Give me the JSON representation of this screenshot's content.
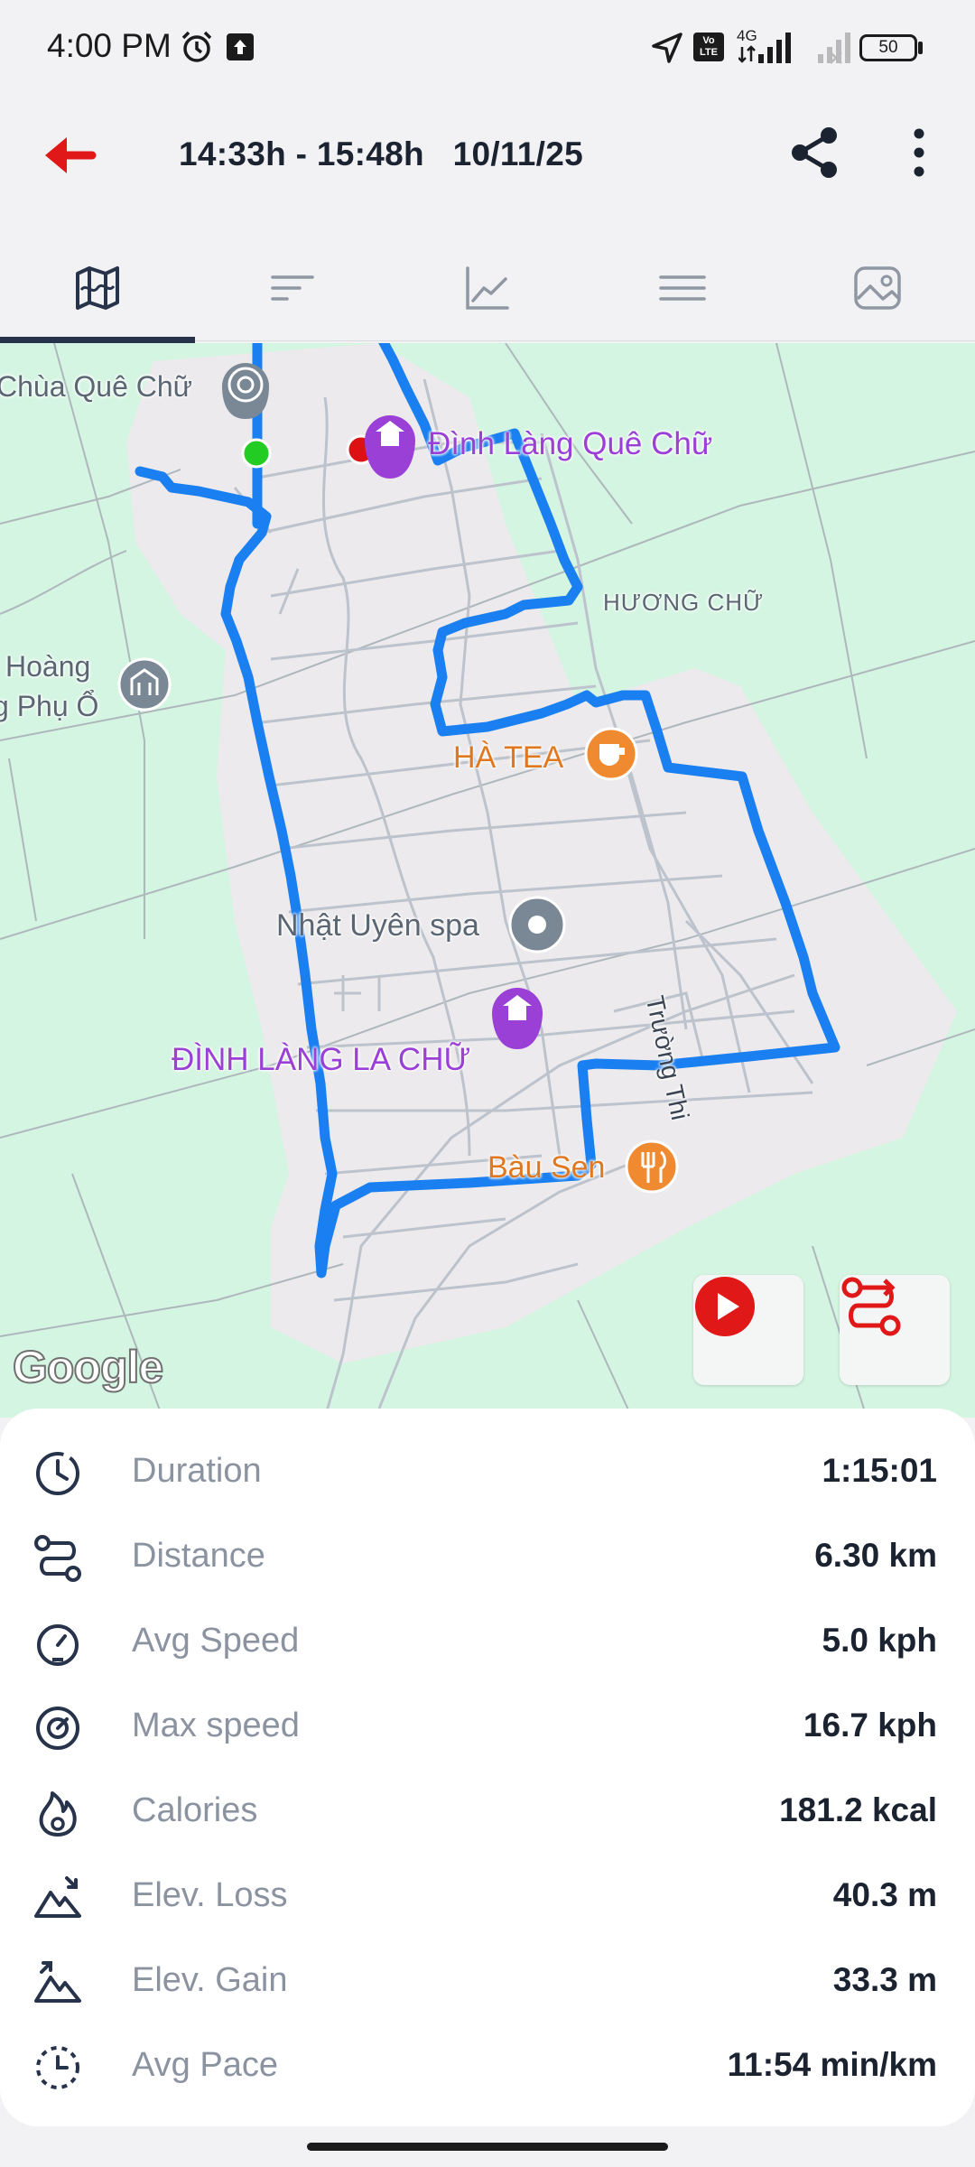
{
  "status_bar": {
    "time": "4:00 PM",
    "network": "4G",
    "volte": "Vo LTE",
    "battery": "50"
  },
  "header": {
    "title": "14:33h - 15:48h   10/11/25"
  },
  "tabs": [
    {
      "icon": "map-icon",
      "selected": true
    },
    {
      "icon": "laps-icon",
      "selected": false
    },
    {
      "icon": "chart-icon",
      "selected": false
    },
    {
      "icon": "menu-lines-icon",
      "selected": false
    },
    {
      "icon": "photo-icon",
      "selected": false
    }
  ],
  "map": {
    "labels": {
      "chua_que_chu": "Chùa Quê Chữ",
      "dinh_lang_que_chu": "Đình Làng Quê Chữ",
      "huong_chu": "HƯƠNG CHỮ",
      "hoang_line1": "Hoàng",
      "hoang_line2": "g Phụ Ổ",
      "ha_tea": "HÀ TEA",
      "nhat_uyen_spa": "Nhật Uyên spa",
      "truong_thi": "Trường Thi",
      "dinh_lang_la_chu": "ĐÌNH LÀNG LA CHỮ",
      "bau_sen": "Bàu Sen"
    },
    "logo_text": "Google",
    "colors": {
      "route": "#1a7ff0",
      "start": "#22cc22",
      "end": "#dd1111",
      "poi_purple": "#9b40d6",
      "poi_orange": "#f08a30",
      "poi_gray": "#7a8896"
    }
  },
  "stats": [
    {
      "icon": "clock-icon",
      "label": "Duration",
      "value": "1:15:01"
    },
    {
      "icon": "route-icon",
      "label": "Distance",
      "value": "6.30 km"
    },
    {
      "icon": "speedometer-icon",
      "label": "Avg Speed",
      "value": "5.0 kph"
    },
    {
      "icon": "max-speed-icon",
      "label": "Max speed",
      "value": "16.7 kph"
    },
    {
      "icon": "flame-icon",
      "label": "Calories",
      "value": "181.2 kcal"
    },
    {
      "icon": "elevation-loss-icon",
      "label": "Elev. Loss",
      "value": "40.3 m"
    },
    {
      "icon": "elevation-gain-icon",
      "label": "Elev. Gain",
      "value": "33.3 m"
    },
    {
      "icon": "pace-icon",
      "label": "Avg Pace",
      "value": "11:54 min/km"
    }
  ]
}
